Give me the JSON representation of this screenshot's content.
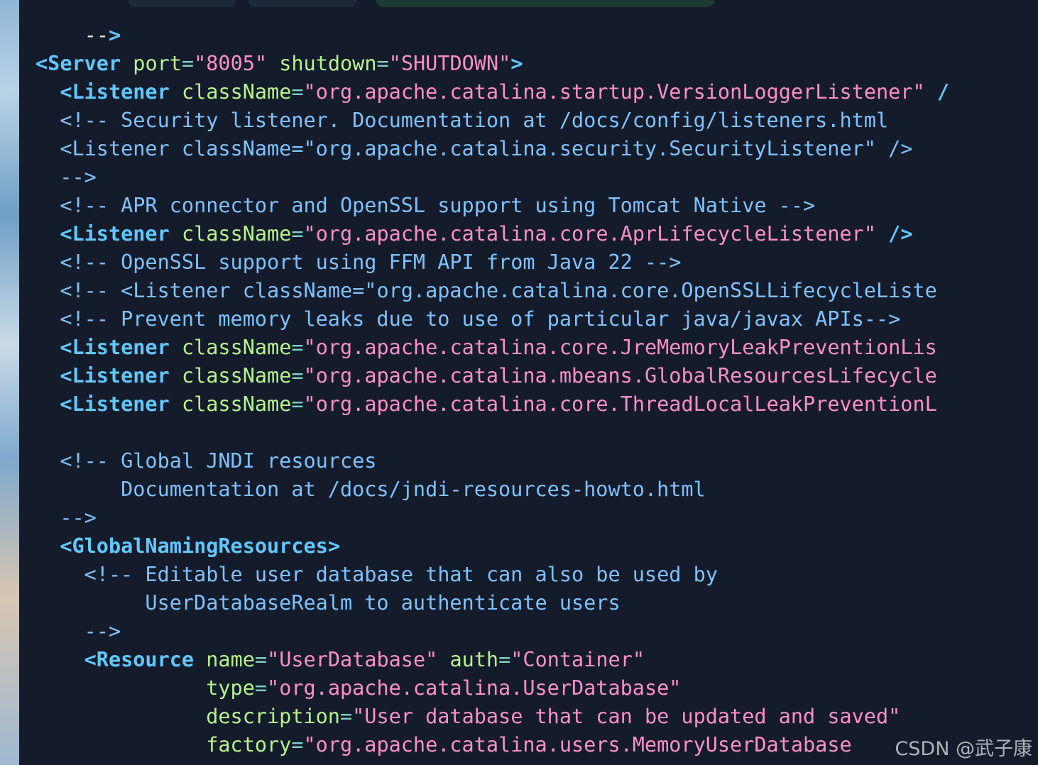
{
  "editor": {
    "lines": [
      "    -->",
      "<Server port=\"8005\" shutdown=\"SHUTDOWN\">",
      "  <Listener className=\"org.apache.catalina.startup.VersionLoggerListener\" /",
      "  <!-- Security listener. Documentation at /docs/config/listeners.html",
      "  <Listener className=\"org.apache.catalina.security.SecurityListener\" />",
      "  -->",
      "  <!-- APR connector and OpenSSL support using Tomcat Native -->",
      "  <Listener className=\"org.apache.catalina.core.AprLifecycleListener\" />",
      "  <!-- OpenSSL support using FFM API from Java 22 -->",
      "  <!-- <Listener className=\"org.apache.catalina.core.OpenSSLLifecycleListe",
      "  <!-- Prevent memory leaks due to use of particular java/javax APIs-->",
      "  <Listener className=\"org.apache.catalina.core.JreMemoryLeakPreventionLis",
      "  <Listener className=\"org.apache.catalina.mbeans.GlobalResourcesLifecycle",
      "  <Listener className=\"org.apache.catalina.core.ThreadLocalLeakPreventionL",
      "",
      "  <!-- Global JNDI resources",
      "       Documentation at /docs/jndi-resources-howto.html",
      "  -->",
      "  <GlobalNamingResources>",
      "    <!-- Editable user database that can also be used by",
      "         UserDatabaseRealm to authenticate users",
      "    -->",
      "    <Resource name=\"UserDatabase\" auth=\"Container\"",
      "              type=\"org.apache.catalina.UserDatabase\"",
      "              description=\"User database that can be updated and saved\"",
      "              factory=\"org.apache.catalina.users.MemoryUserDatabase"
    ]
  },
  "watermark": "CSDN @武子康"
}
